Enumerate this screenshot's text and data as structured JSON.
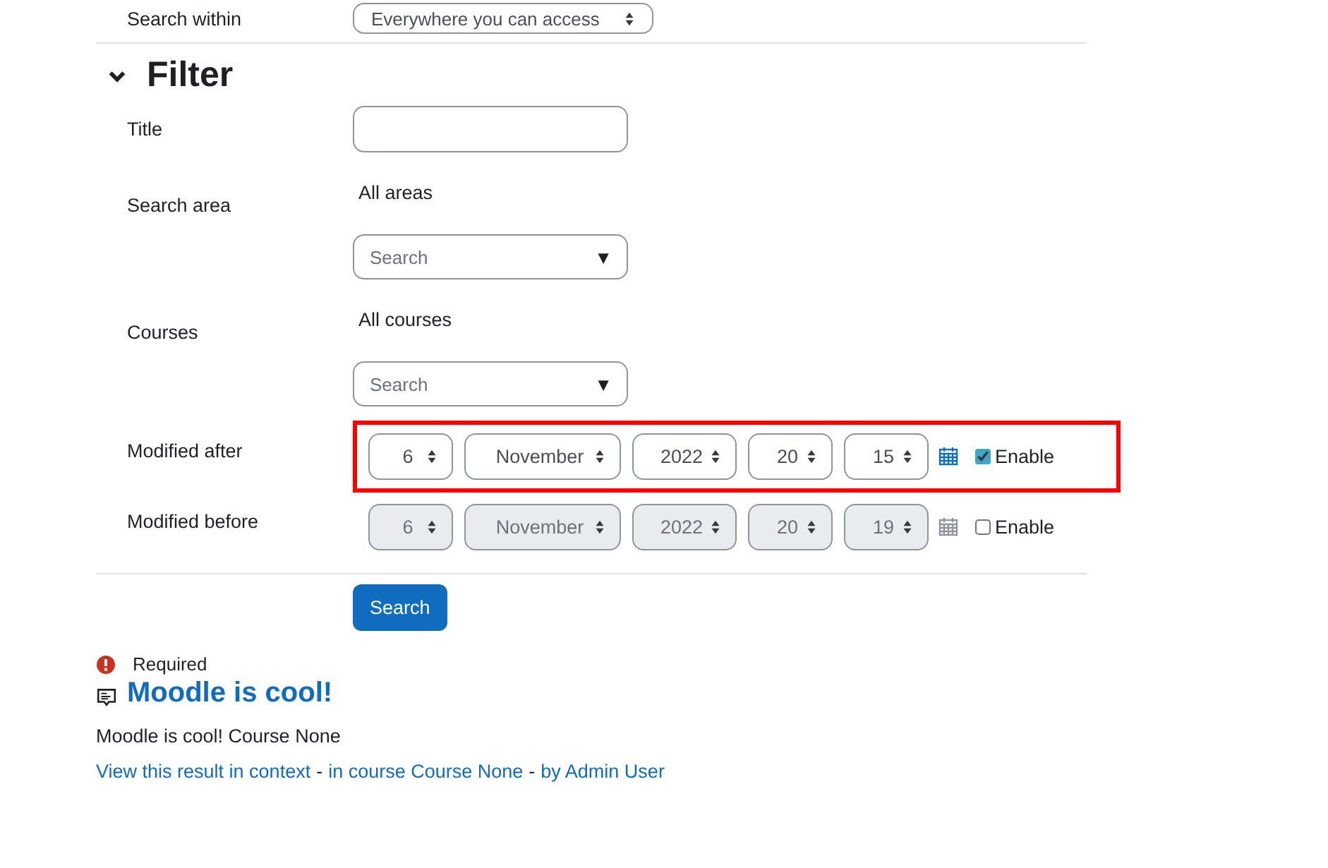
{
  "search_within": {
    "label": "Search within",
    "value": "Everywhere you can access"
  },
  "filter": {
    "title": "Filter",
    "expanded": true,
    "title_field": {
      "label": "Title"
    },
    "search_area": {
      "label": "Search area",
      "selection": "All areas",
      "placeholder": "Search",
      "arrow": "▼"
    },
    "courses": {
      "label": "Courses",
      "selection": "All courses",
      "placeholder": "Search",
      "arrow": "▼"
    },
    "date_rows": [
      {
        "label": "Modified after",
        "highlighted": true,
        "enabled": true,
        "enable_label": "Enable",
        "fields": [
          "6",
          "November",
          "2022",
          "20",
          "15"
        ]
      },
      {
        "label": "Modified before",
        "highlighted": false,
        "enabled": false,
        "enable_label": "Enable",
        "fields": [
          "6",
          "November",
          "2022",
          "20",
          "19"
        ]
      }
    ],
    "search_button": "Search"
  },
  "required_note": "Required",
  "result": {
    "title": "Moodle is cool!",
    "summary": "Moodle is cool! Course None",
    "links": [
      {
        "kind": "link",
        "text": "View this result in context"
      },
      {
        "kind": "sep",
        "text": "-"
      },
      {
        "kind": "link",
        "text": "in course Course None"
      },
      {
        "kind": "sep",
        "text": "-"
      },
      {
        "kind": "link",
        "text": "by Admin User"
      }
    ]
  }
}
